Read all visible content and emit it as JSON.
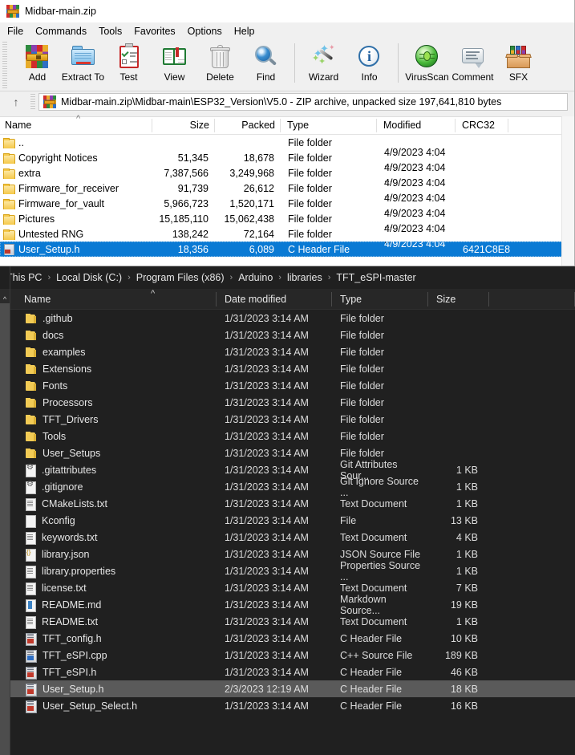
{
  "winrar": {
    "title": "Midbar-main.zip",
    "app_icon": "winrar-archive-icon",
    "menus": [
      "File",
      "Commands",
      "Tools",
      "Favorites",
      "Options",
      "Help"
    ],
    "toolbar": [
      {
        "label": "Add",
        "icon": "add-archive-icon"
      },
      {
        "label": "Extract To",
        "icon": "extract-folder-icon"
      },
      {
        "label": "Test",
        "icon": "test-clipboard-icon"
      },
      {
        "label": "View",
        "icon": "view-book-icon"
      },
      {
        "label": "Delete",
        "icon": "delete-trash-icon"
      },
      {
        "label": "Find",
        "icon": "find-magnifier-icon"
      },
      {
        "label": "Wizard",
        "icon": "wizard-wand-icon"
      },
      {
        "label": "Info",
        "icon": "info-circle-icon"
      },
      {
        "label": "VirusScan",
        "icon": "virusscan-bug-icon"
      },
      {
        "label": "Comment",
        "icon": "comment-bubble-icon"
      },
      {
        "label": "SFX",
        "icon": "sfx-box-icon"
      }
    ],
    "up_icon": "up-arrow-icon",
    "path": "Midbar-main.zip\\Midbar-main\\ESP32_Version\\V5.0 - ZIP archive, unpacked size 197,641,810 bytes",
    "columns": [
      "Name",
      "Size",
      "Packed",
      "Type",
      "Modified",
      "CRC32"
    ],
    "sort_caret": "^",
    "rows": [
      {
        "icon": "folder-icon",
        "name": "..",
        "size": "",
        "packed": "",
        "type": "File folder",
        "modified": "",
        "crc": "",
        "selected": false
      },
      {
        "icon": "folder-icon",
        "name": "Copyright Notices",
        "size": "51,345",
        "packed": "18,678",
        "type": "File folder",
        "modified": "4/9/2023 4:04 ...",
        "crc": "",
        "selected": false
      },
      {
        "icon": "folder-icon",
        "name": "extra",
        "size": "7,387,566",
        "packed": "3,249,968",
        "type": "File folder",
        "modified": "4/9/2023 4:04 ...",
        "crc": "",
        "selected": false
      },
      {
        "icon": "folder-icon",
        "name": "Firmware_for_receiver",
        "size": "91,739",
        "packed": "26,612",
        "type": "File folder",
        "modified": "4/9/2023 4:04 ...",
        "crc": "",
        "selected": false
      },
      {
        "icon": "folder-icon",
        "name": "Firmware_for_vault",
        "size": "5,966,723",
        "packed": "1,520,171",
        "type": "File folder",
        "modified": "4/9/2023 4:04 ...",
        "crc": "",
        "selected": false
      },
      {
        "icon": "folder-icon",
        "name": "Pictures",
        "size": "15,185,110",
        "packed": "15,062,438",
        "type": "File folder",
        "modified": "4/9/2023 4:04 ...",
        "crc": "",
        "selected": false
      },
      {
        "icon": "folder-icon",
        "name": "Untested RNG",
        "size": "138,242",
        "packed": "72,164",
        "type": "File folder",
        "modified": "4/9/2023 4:04 ...",
        "crc": "",
        "selected": false
      },
      {
        "icon": "c-header-icon",
        "name": "User_Setup.h",
        "size": "18,356",
        "packed": "6,089",
        "type": "C Header File",
        "modified": "4/9/2023 4:04 ...",
        "crc": "6421C8E8",
        "selected": true
      }
    ],
    "selection_color": "#0a7ad4"
  },
  "explorer": {
    "breadcrumb": [
      "This PC",
      "Local Disk (C:)",
      "Program Files (x86)",
      "Arduino",
      "libraries",
      "TFT_eSPI-master"
    ],
    "breadcrumb_separator": "›",
    "columns": [
      "Name",
      "Date modified",
      "Type",
      "Size"
    ],
    "sort_caret": "^",
    "scroll_chevron": "^",
    "selection_color": "#5a5a5a",
    "rows": [
      {
        "icon": "folder-icon",
        "name": ".github",
        "date": "1/31/2023 3:14 AM",
        "type": "File folder",
        "size": "",
        "selected": false
      },
      {
        "icon": "folder-icon",
        "name": "docs",
        "date": "1/31/2023 3:14 AM",
        "type": "File folder",
        "size": "",
        "selected": false
      },
      {
        "icon": "folder-icon",
        "name": "examples",
        "date": "1/31/2023 3:14 AM",
        "type": "File folder",
        "size": "",
        "selected": false
      },
      {
        "icon": "folder-icon",
        "name": "Extensions",
        "date": "1/31/2023 3:14 AM",
        "type": "File folder",
        "size": "",
        "selected": false
      },
      {
        "icon": "folder-icon",
        "name": "Fonts",
        "date": "1/31/2023 3:14 AM",
        "type": "File folder",
        "size": "",
        "selected": false
      },
      {
        "icon": "folder-icon",
        "name": "Processors",
        "date": "1/31/2023 3:14 AM",
        "type": "File folder",
        "size": "",
        "selected": false
      },
      {
        "icon": "folder-icon",
        "name": "TFT_Drivers",
        "date": "1/31/2023 3:14 AM",
        "type": "File folder",
        "size": "",
        "selected": false
      },
      {
        "icon": "folder-icon",
        "name": "Tools",
        "date": "1/31/2023 3:14 AM",
        "type": "File folder",
        "size": "",
        "selected": false
      },
      {
        "icon": "folder-icon",
        "name": "User_Setups",
        "date": "1/31/2023 3:14 AM",
        "type": "File folder",
        "size": "",
        "selected": false
      },
      {
        "icon": "gear-file-icon",
        "name": ".gitattributes",
        "date": "1/31/2023 3:14 AM",
        "type": "Git Attributes Sour...",
        "size": "1 KB",
        "selected": false
      },
      {
        "icon": "gear-file-icon",
        "name": ".gitignore",
        "date": "1/31/2023 3:14 AM",
        "type": "Git Ignore Source ...",
        "size": "1 KB",
        "selected": false
      },
      {
        "icon": "text-file-icon",
        "name": "CMakeLists.txt",
        "date": "1/31/2023 3:14 AM",
        "type": "Text Document",
        "size": "1 KB",
        "selected": false
      },
      {
        "icon": "blank-file-icon",
        "name": "Kconfig",
        "date": "1/31/2023 3:14 AM",
        "type": "File",
        "size": "13 KB",
        "selected": false
      },
      {
        "icon": "text-file-icon",
        "name": "keywords.txt",
        "date": "1/31/2023 3:14 AM",
        "type": "Text Document",
        "size": "4 KB",
        "selected": false
      },
      {
        "icon": "json-file-icon",
        "name": "library.json",
        "date": "1/31/2023 3:14 AM",
        "type": "JSON Source File",
        "size": "1 KB",
        "selected": false
      },
      {
        "icon": "text-file-icon",
        "name": "library.properties",
        "date": "1/31/2023 3:14 AM",
        "type": "Properties Source ...",
        "size": "1 KB",
        "selected": false
      },
      {
        "icon": "text-file-icon",
        "name": "license.txt",
        "date": "1/31/2023 3:14 AM",
        "type": "Text Document",
        "size": "7 KB",
        "selected": false
      },
      {
        "icon": "markdown-file-icon",
        "name": "README.md",
        "date": "1/31/2023 3:14 AM",
        "type": "Markdown Source...",
        "size": "19 KB",
        "selected": false
      },
      {
        "icon": "text-file-icon",
        "name": "README.txt",
        "date": "1/31/2023 3:14 AM",
        "type": "Text Document",
        "size": "1 KB",
        "selected": false
      },
      {
        "icon": "c-header-icon",
        "name": "TFT_config.h",
        "date": "1/31/2023 3:14 AM",
        "type": "C Header File",
        "size": "10 KB",
        "selected": false
      },
      {
        "icon": "cpp-source-icon",
        "name": "TFT_eSPI.cpp",
        "date": "1/31/2023 3:14 AM",
        "type": "C++ Source File",
        "size": "189 KB",
        "selected": false
      },
      {
        "icon": "c-header-icon",
        "name": "TFT_eSPI.h",
        "date": "1/31/2023 3:14 AM",
        "type": "C Header File",
        "size": "46 KB",
        "selected": false
      },
      {
        "icon": "c-header-icon",
        "name": "User_Setup.h",
        "date": "2/3/2023 12:19 AM",
        "type": "C Header File",
        "size": "18 KB",
        "selected": true
      },
      {
        "icon": "c-header-icon",
        "name": "User_Setup_Select.h",
        "date": "1/31/2023 3:14 AM",
        "type": "C Header File",
        "size": "16 KB",
        "selected": false
      }
    ]
  }
}
